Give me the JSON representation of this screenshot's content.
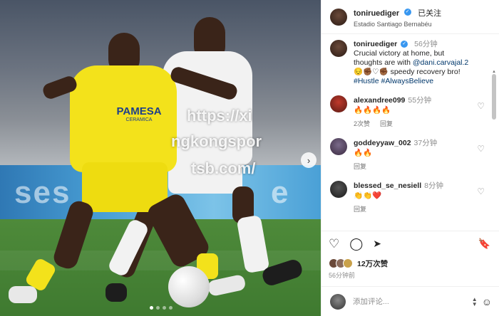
{
  "post": {
    "username": "toniruediger",
    "follow_status": "已关注",
    "location": "Estadio Santiago Bernabéu",
    "caption_time": "56分钟",
    "caption_line1": "Crucial victory at home, but",
    "caption_line2_prefix": "thoughts are with ",
    "caption_mention": "@dani.carvajal.2",
    "caption_emojis": "😔✊🏾♡✊🏾",
    "caption_tail": "speedy recovery bro!",
    "hashtags": "#Hustle #AlwaysBelieve",
    "likes_text": "12万次赞",
    "posted_ago": "56分钟前",
    "add_comment_placeholder": "添加评论..."
  },
  "photo": {
    "watermark_line1": "https://xi",
    "watermark_line2": "ngkongspor",
    "watermark_line3": "tsb.com/",
    "shirt_sponsor": "PAMESA",
    "shirt_sponsor_sub": "CERAMICA",
    "board_text": "ses",
    "board_text_right": "e",
    "next_arrow": "›"
  },
  "comments": [
    {
      "user": "alexandree099",
      "time": "55分钟",
      "text": "🔥🔥🔥🔥",
      "likes_label": "2次赞",
      "reply_label": "回复"
    },
    {
      "user": "goddeyyaw_002",
      "time": "37分钟",
      "text": "🔥🔥",
      "likes_label": "",
      "reply_label": "回复"
    },
    {
      "user": "blessed_se_nesiell",
      "time": "8分钟",
      "text": "👏👏❤️",
      "likes_label": "",
      "reply_label": "回复"
    }
  ],
  "icons": {
    "heart": "♡",
    "comment": "◯",
    "share": "➤",
    "bookmark": "🔖",
    "emoji": "☺"
  },
  "colors": {
    "verified": "#3897f0",
    "link": "#00376b",
    "villarreal_yellow": "#f3e21b"
  }
}
